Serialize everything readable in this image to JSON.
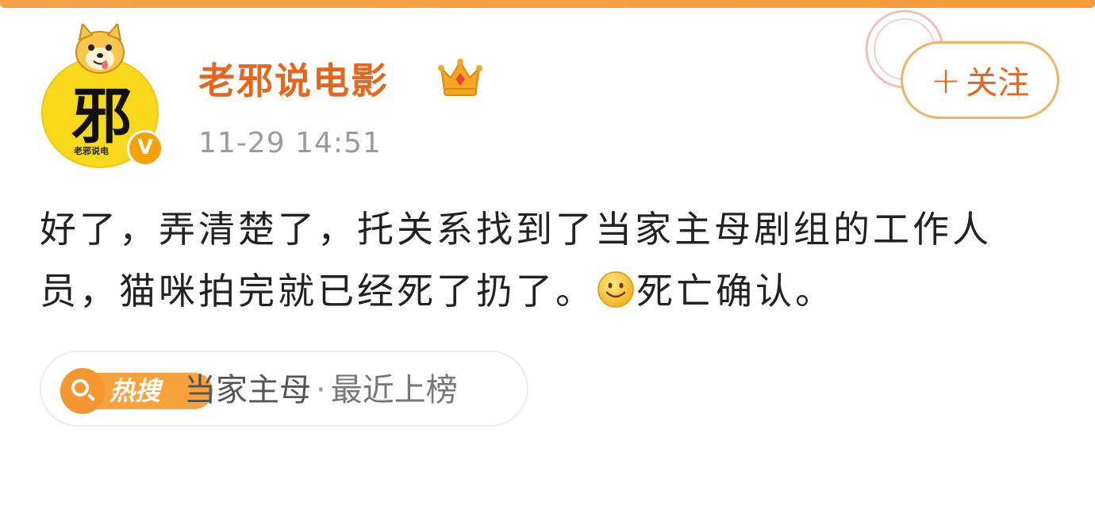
{
  "post": {
    "author": {
      "name": "老邪说电影",
      "avatar_icon": "dog-mascot-avatar",
      "verified_mark": "V"
    },
    "timestamp": "11-29 14:51",
    "follow_button": {
      "plus": "+",
      "label": "关注"
    },
    "text_before_emoji": "好了，弄清楚了，托关系找到了当家主母剧组的工作人员，猫咪拍完就已经死了扔了。",
    "emoji_icon": "smiley-icon",
    "text_after_emoji": "死亡确认。",
    "hot_search": {
      "badge": "热搜",
      "topic": "当家主母",
      "separator": "·",
      "status": "最近上榜"
    }
  },
  "colors": {
    "brand_orange": "#e5661c",
    "top_bar": "#f7a24a",
    "avatar_yellow": "#f8d81b",
    "hot_badge": "#f7a23c"
  }
}
